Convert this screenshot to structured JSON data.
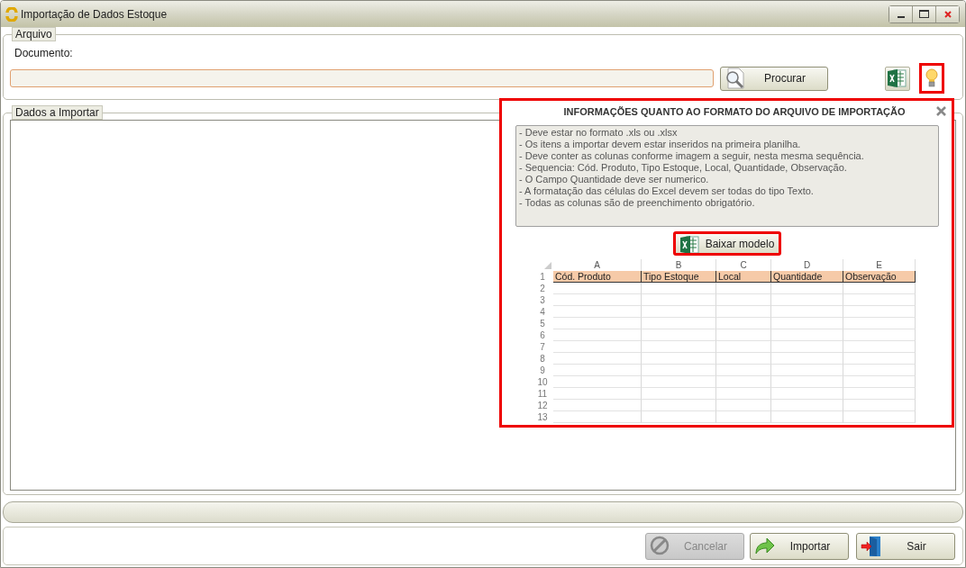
{
  "window": {
    "title": "Importação de Dados Estoque"
  },
  "arquivo": {
    "legend": "Arquivo",
    "label": "Documento:",
    "browse_button": "Procurar",
    "hint_highlighted": true
  },
  "dados": {
    "legend": "Dados a Importar"
  },
  "info_popup": {
    "title": "INFORMAÇÕES QUANTO AO FORMATO DO ARQUIVO DE IMPORTAÇÃO",
    "highlighted": true,
    "lines": [
      "- Deve estar no formato .xls ou .xlsx",
      "- Os itens a importar devem estar inseridos na primeira planilha.",
      "- Deve conter as colunas conforme imagem a seguir, nesta mesma sequência.",
      "- Sequencia: Cód. Produto, Tipo Estoque, Local, Quantidade, Observação.",
      "- O Campo Quantidade deve ser numerico.",
      "- A formatação das células do Excel devem ser todas do tipo Texto.",
      "- Todas as colunas são de preenchimento obrigatório."
    ],
    "download_button": {
      "label": "Baixar modelo",
      "highlighted": true
    },
    "sheet": {
      "columns": [
        "A",
        "B",
        "C",
        "D",
        "E"
      ],
      "header_row": {
        "number": "1",
        "cells": [
          "Cód. Produto",
          "Tipo Estoque",
          "Local",
          "Quantidade",
          "Observação"
        ]
      },
      "row_numbers": [
        "2",
        "3",
        "4",
        "5",
        "6",
        "7",
        "8",
        "9",
        "10",
        "11",
        "12",
        "13"
      ]
    }
  },
  "progress": {
    "level": 0
  },
  "buttons": [
    {
      "label": "Cancelar",
      "kind": "cancel",
      "disabled": true
    },
    {
      "label": "Importar",
      "kind": "import",
      "disabled": false
    },
    {
      "label": "Sair",
      "kind": "exit",
      "disabled": false
    }
  ]
}
